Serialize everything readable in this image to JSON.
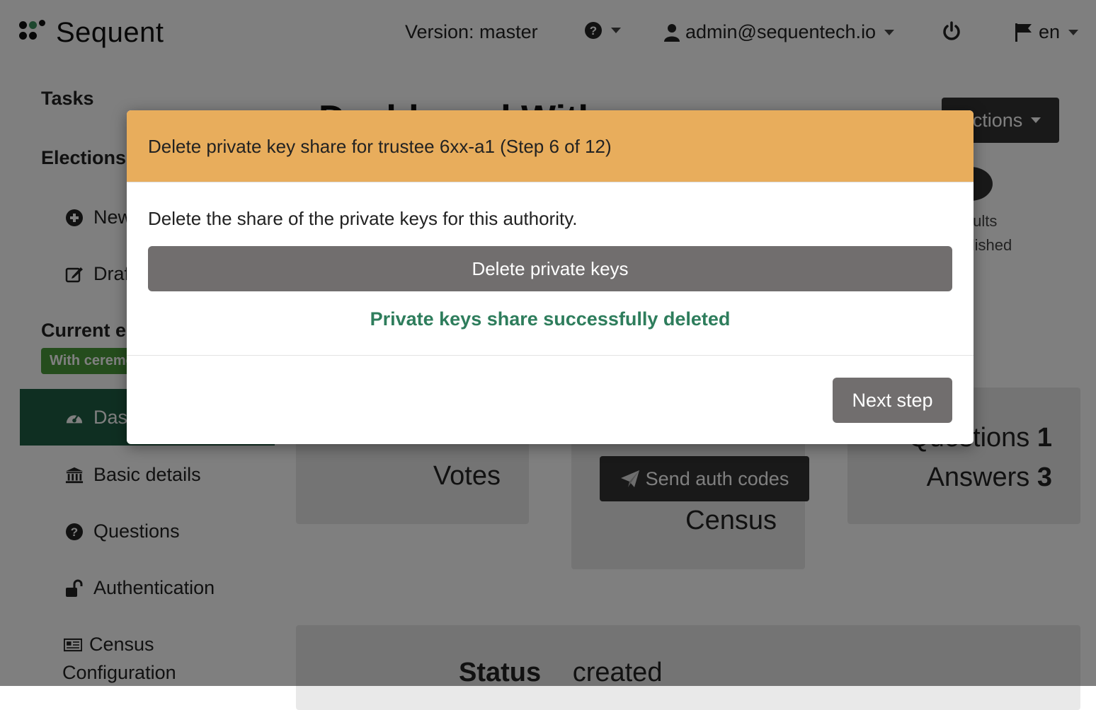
{
  "header": {
    "logo_text": "Sequent",
    "version": "Version: master",
    "user_email": "admin@sequentech.io",
    "language": "en"
  },
  "sidebar": {
    "tasks_heading": "Tasks",
    "elections_heading": "Elections",
    "elections_items": [
      {
        "label": "New election",
        "icon": "plus-circle-icon"
      },
      {
        "label": "Drafts",
        "icon": "edit-icon"
      }
    ],
    "current_heading": "Current election",
    "current_badge": "With ceremony",
    "current_items": [
      {
        "label": "Dashboard",
        "icon": "dashboard-icon",
        "active": true
      },
      {
        "label": "Basic details",
        "icon": "bank-icon"
      },
      {
        "label": "Questions",
        "icon": "question-circle-icon"
      },
      {
        "label": "Authentication",
        "icon": "unlock-icon"
      },
      {
        "label": "Census",
        "label2": "Configuration",
        "icon": "newspaper-icon"
      }
    ]
  },
  "main": {
    "title_partial": "Dashboard With ceremony",
    "actions_label": "Actions",
    "results_label_1": "Results",
    "results_label_2": "published",
    "votes_label": "Votes",
    "send_auth_codes_label": "Send auth codes",
    "census_label": "Census",
    "questions_label": "Questions",
    "questions_count": "1",
    "answers_label": "Answers",
    "answers_count": "3",
    "status_label": "Status",
    "status_value": "created"
  },
  "modal": {
    "title": "Delete private key share for trustee 6xx-a1 (Step 6 of 12)",
    "description": "Delete the share of the private keys for this authority.",
    "delete_button": "Delete private keys",
    "success_message": "Private keys share successfully deleted",
    "next_button": "Next step"
  },
  "colors": {
    "modal_header": "#e8ad5c",
    "success_text": "#2e7d5c",
    "active_sidebar": "#1f5e44",
    "badge": "#4a9a3a",
    "button": "#716e6e"
  }
}
